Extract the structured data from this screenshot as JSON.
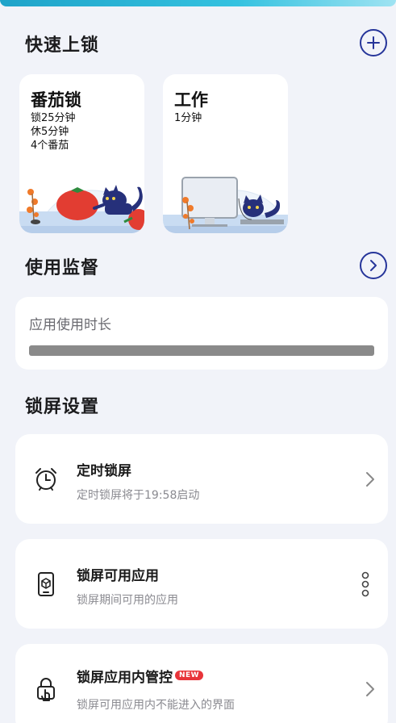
{
  "quick_lock": {
    "title": "快速上锁",
    "add_icon": "plus-circle-icon",
    "cards": [
      {
        "title": "番茄锁",
        "lines": [
          "锁25分钟",
          "休5分钟",
          "4个番茄"
        ]
      },
      {
        "title": "工作",
        "lines": [
          "1分钟"
        ]
      }
    ]
  },
  "usage": {
    "title": "使用监督",
    "arrow_icon": "chevron-right-circle-icon",
    "card_label": "应用使用时长"
  },
  "lock_settings": {
    "title": "锁屏设置",
    "items": [
      {
        "title": "定时锁屏",
        "subtitle": "定时锁屏将于19:58启动",
        "icon": "alarm-clock-icon",
        "action": "chevron-right-icon"
      },
      {
        "title": "锁屏可用应用",
        "subtitle": "锁屏期间可用的应用",
        "icon": "phone-app-icon",
        "action": "more-vertical-icon"
      },
      {
        "title": "锁屏应用内管控",
        "badge": "NEW",
        "subtitle": "锁屏可用应用内不能进入的界面",
        "icon": "lock-touch-icon",
        "action": "chevron-right-icon"
      }
    ]
  },
  "colors": {
    "accent": "#26359a",
    "background": "#f1f3f9",
    "badge": "#e8343a"
  }
}
